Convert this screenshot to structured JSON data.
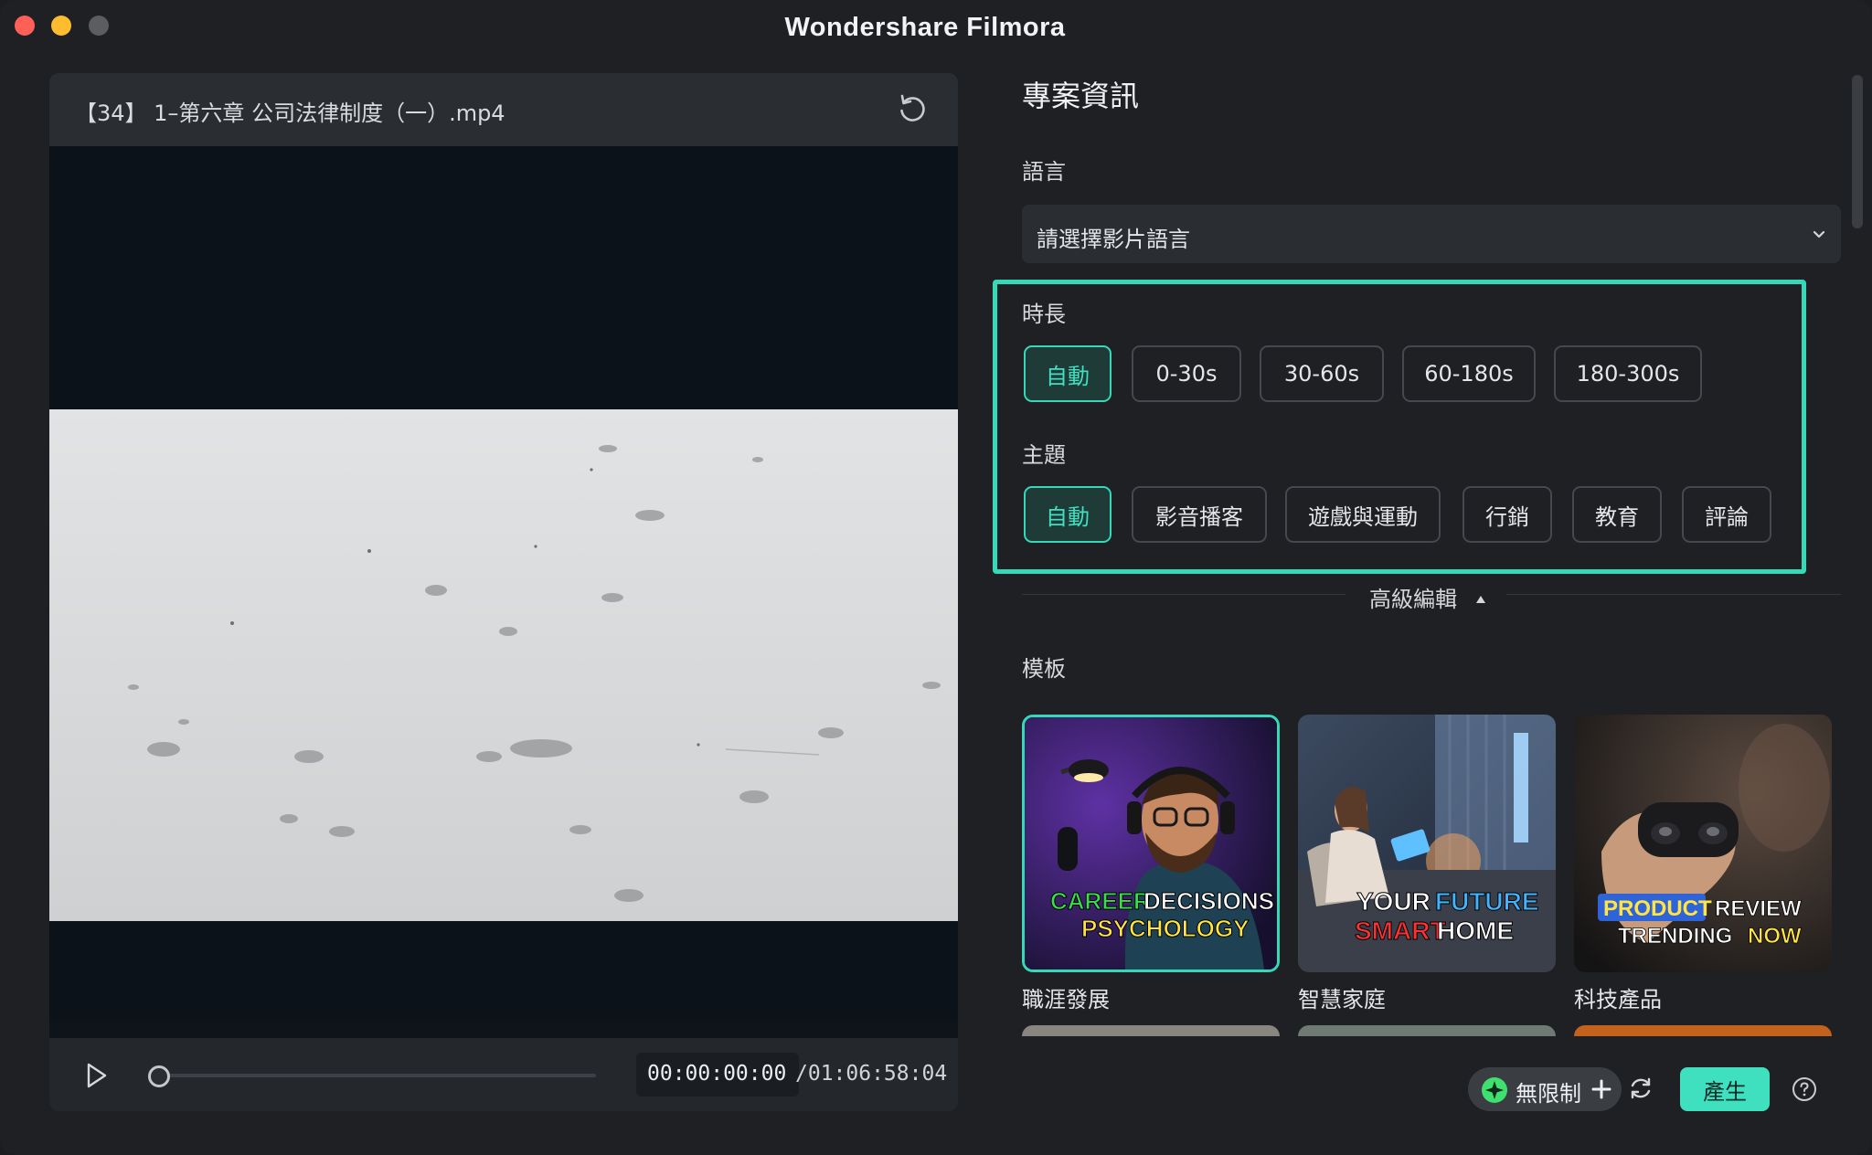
{
  "window": {
    "title": "Wondershare Filmora"
  },
  "preview": {
    "file_name": "【34】 1–第六章 公司法律制度（一）.mp4",
    "current_time": "00:00:00:00",
    "total_time": "/01:06:58:04",
    "progress": 0
  },
  "project": {
    "title": "專案資訊",
    "language_label": "語言",
    "language_placeholder": "請選擇影片語言",
    "duration_label": "時長",
    "duration_options": [
      "自動",
      "0-30s",
      "30-60s",
      "60-180s",
      "180-300s"
    ],
    "duration_selected": "自動",
    "theme_label": "主題",
    "theme_options": [
      "自動",
      "影音播客",
      "遊戲與運動",
      "行銷",
      "教育",
      "評論"
    ],
    "theme_selected": "自動",
    "advanced_label": "高級編輯",
    "templates_label": "模板",
    "templates": [
      {
        "name": "職涯發展",
        "thumb_text": [
          "CAREER",
          "DECISIONS",
          "PSYCHOLOGY"
        ],
        "selected": true
      },
      {
        "name": "智慧家庭",
        "thumb_text": [
          "YOUR",
          "FUTURE",
          "SMART",
          "HOME"
        ],
        "selected": false
      },
      {
        "name": "科技產品",
        "thumb_text": [
          "PRODUCT",
          "REVIEW",
          "TRENDING",
          "NOW"
        ],
        "selected": false
      }
    ]
  },
  "footer": {
    "plan_label": "無限制",
    "generate_label": "產生"
  },
  "colors": {
    "accent": "#35d8b7",
    "accent_text": "#3fe0c0",
    "window_bg": "#1e2024",
    "panel_bg": "#2a2d32",
    "close": "#fe5f57",
    "minimize": "#febc2e"
  },
  "icons": [
    "refresh-icon",
    "play-icon",
    "chevron-down-icon",
    "caret-up-icon",
    "unlimited-icon",
    "plus-icon",
    "sync-icon",
    "help-icon"
  ]
}
